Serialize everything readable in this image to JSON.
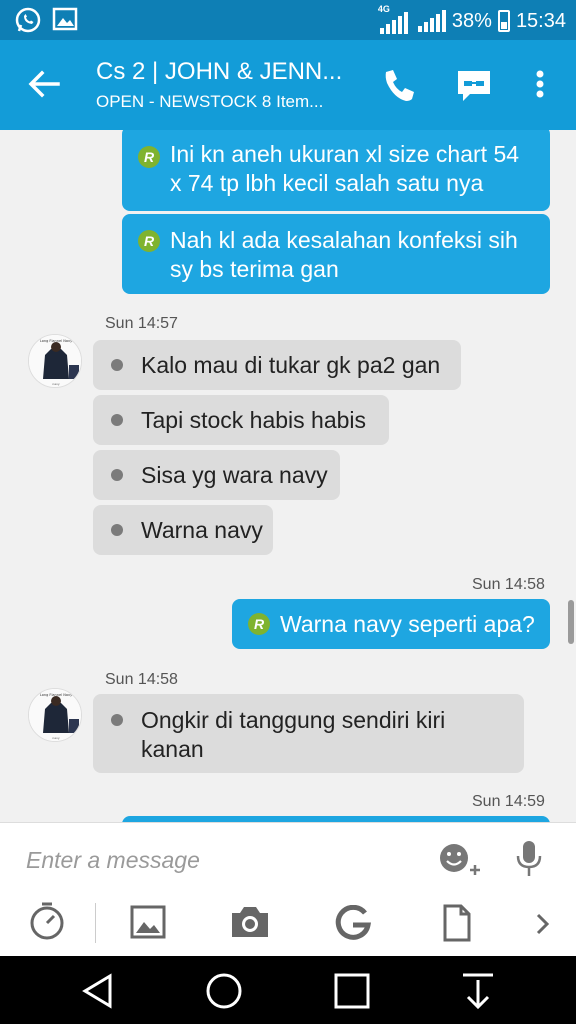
{
  "status_bar": {
    "network_label": "4G",
    "battery": "38%",
    "time": "15:34",
    "icons": [
      "whatsapp-icon",
      "gallery-icon"
    ]
  },
  "header": {
    "title": "Cs 2 | JOHN & JENN...",
    "subtitle": "OPEN - NEWSTOCK 8 Item..."
  },
  "messages": [
    {
      "type": "out",
      "badge": "R",
      "lines": [
        "Ini kn aneh ukuran xl size chart 54",
        "x 74 tp lbh kecil salah satu nya"
      ]
    },
    {
      "type": "out",
      "badge": "R",
      "lines": [
        "Nah kl ada kesalahan konfeksi sih",
        "sy bs terima gan"
      ]
    },
    {
      "type": "timestamp",
      "text": "Sun 14:57"
    },
    {
      "type": "in",
      "lines": [
        "Kalo mau di tukar gk pa2 gan"
      ]
    },
    {
      "type": "in",
      "lines": [
        "Tapi stock habis habis"
      ]
    },
    {
      "type": "in",
      "lines": [
        "Sisa yg wara navy"
      ]
    },
    {
      "type": "in",
      "lines": [
        "Warna navy"
      ]
    },
    {
      "type": "timestamp",
      "text": "Sun 14:58"
    },
    {
      "type": "out",
      "badge": "R",
      "lines": [
        "Warna navy seperti apa?"
      ]
    },
    {
      "type": "timestamp",
      "text": "Sun 14:58"
    },
    {
      "type": "in",
      "lines": [
        "Ongkir di tanggung sendiri kiri",
        "kanan"
      ]
    },
    {
      "type": "timestamp",
      "text": "Sun 14:59"
    }
  ],
  "composer": {
    "placeholder": "Enter a message"
  },
  "colors": {
    "status_bar": "#0e7fb5",
    "app_bar": "#139cd8",
    "outgoing": "#1ea6e1",
    "incoming": "#dcdcdc",
    "badge": "#7fb32f"
  }
}
